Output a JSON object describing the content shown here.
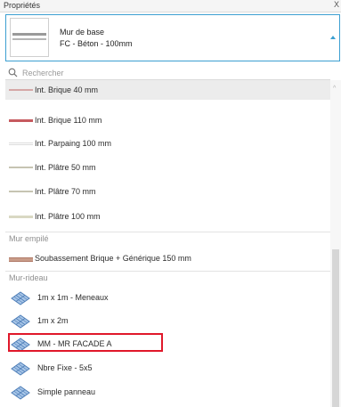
{
  "panel": {
    "title": "Propriétés",
    "close": "X"
  },
  "type_selector": {
    "family": "Mur de base",
    "type": "FC - Béton - 100mm"
  },
  "search": {
    "placeholder": "Rechercher"
  },
  "basic_walls": [
    {
      "label": "Int. Brique 40 mm",
      "color": "#d5a7a6"
    },
    {
      "label": "Int. Brique 110 mm",
      "color": "#c65a5f"
    },
    {
      "label": "Int. Parpaing 100 mm",
      "color": "#e6e6e6"
    },
    {
      "label": "Int. Plâtre 50 mm",
      "color": "#c6c4b2"
    },
    {
      "label": "Int. Plâtre 70 mm",
      "color": "#c6c4b2"
    },
    {
      "label": "Int. Plâtre 100 mm",
      "color": "#d9d8c3"
    }
  ],
  "stacked_group": {
    "title": "Mur empilé",
    "items": [
      {
        "label": "Soubassement Brique + Générique 150 mm",
        "color": "#c99c89"
      }
    ]
  },
  "curtain_group": {
    "title": "Mur-rideau",
    "items": [
      {
        "label": "1m x 1m - Meneaux",
        "icon": "curtain-wall-icon"
      },
      {
        "label": "1m x 2m",
        "icon": "curtain-wall-icon"
      },
      {
        "label": "MM - MR FACADE A",
        "icon": "curtain-wall-icon"
      },
      {
        "label": "Nbre Fixe - 5x5",
        "icon": "curtain-wall-icon"
      },
      {
        "label": "Simple panneau",
        "icon": "curtain-wall-icon"
      }
    ]
  },
  "highlight": {
    "target": "MM - MR FACADE A",
    "color": "#e0182a"
  },
  "accent_color": "#3c9fd1"
}
